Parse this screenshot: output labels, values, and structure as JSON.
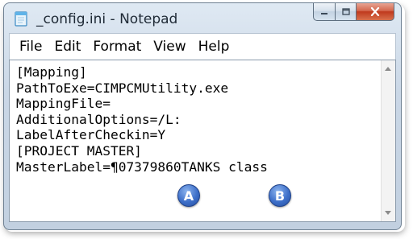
{
  "window": {
    "title": "_config.ini - Notepad"
  },
  "menu": [
    {
      "label": "File"
    },
    {
      "label": "Edit"
    },
    {
      "label": "Format"
    },
    {
      "label": "View"
    },
    {
      "label": "Help"
    }
  ],
  "editor": {
    "lines": [
      "[Mapping]",
      "PathToExe=CIMPCMUtility.exe",
      "MappingFile=",
      "AdditionalOptions=/L:",
      "LabelAfterCheckin=Y",
      "[PROJECT MASTER]",
      "MasterLabel=¶07379860TANKS class"
    ]
  },
  "callouts": {
    "a": "A",
    "b": "B"
  },
  "colors": {
    "badge": "#3d6fc9",
    "close_button": "#c0391d"
  },
  "icons": {
    "app": "notepad-icon",
    "minimize": "minimize-icon",
    "maximize": "maximize-icon",
    "close": "close-icon"
  }
}
